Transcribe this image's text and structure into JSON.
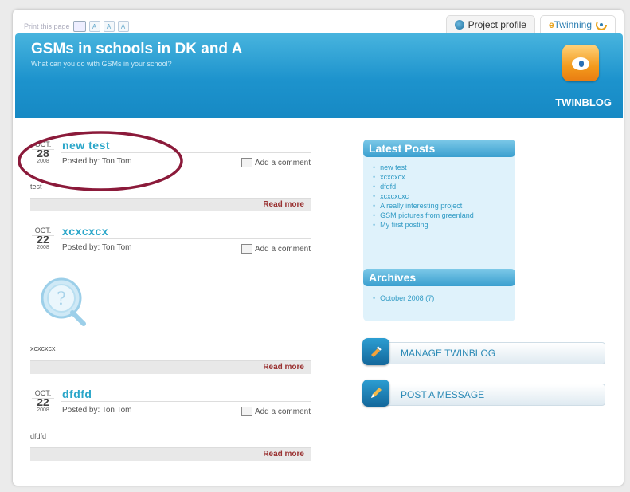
{
  "topbar": {
    "print_label": "Print this page",
    "font_small": "A",
    "font_medium": "A",
    "font_large": "A"
  },
  "nav": {
    "project_profile": "Project profile",
    "etwinning_e": "e",
    "etwinning_rest": "Twinning"
  },
  "header": {
    "title": "GSMs in schools in DK and A",
    "subtitle": "What can you do with GSMs in your school?",
    "logo_label": "TWINBLOG"
  },
  "posts": [
    {
      "month": "OCT.",
      "day": "28",
      "year": "2008",
      "title": "new test",
      "posted_by": "Posted by: Ton Tom",
      "add_comment": "Add a comment",
      "body": "test",
      "read_more": "Read more"
    },
    {
      "month": "OCT.",
      "day": "22",
      "year": "2008",
      "title": "xcxcxcx",
      "posted_by": "Posted by: Ton Tom",
      "add_comment": "Add a comment",
      "body": "xcxcxcx",
      "read_more": "Read more"
    },
    {
      "month": "OCT.",
      "day": "22",
      "year": "2008",
      "title": "dfdfd",
      "posted_by": "Posted by: Ton Tom",
      "add_comment": "Add a comment",
      "body": "dfdfd",
      "read_more": "Read more"
    }
  ],
  "sidebar": {
    "latest_posts_heading": "Latest Posts",
    "latest_posts": [
      "new test",
      "xcxcxcx",
      "dfdfd",
      "xcxcxcxc",
      "A really interesting project",
      "GSM pictures from greenland",
      "My first posting"
    ],
    "archives_heading": "Archives",
    "archives": [
      "October 2008 (7)"
    ]
  },
  "actions": {
    "manage": "MANAGE TWINBLOG",
    "post": "POST A MESSAGE"
  },
  "colors": {
    "header_blue": "#1d93cd",
    "title_cyan": "#2aa6c9",
    "read_more_red": "#993030",
    "annotation": "#8b1a3a"
  }
}
